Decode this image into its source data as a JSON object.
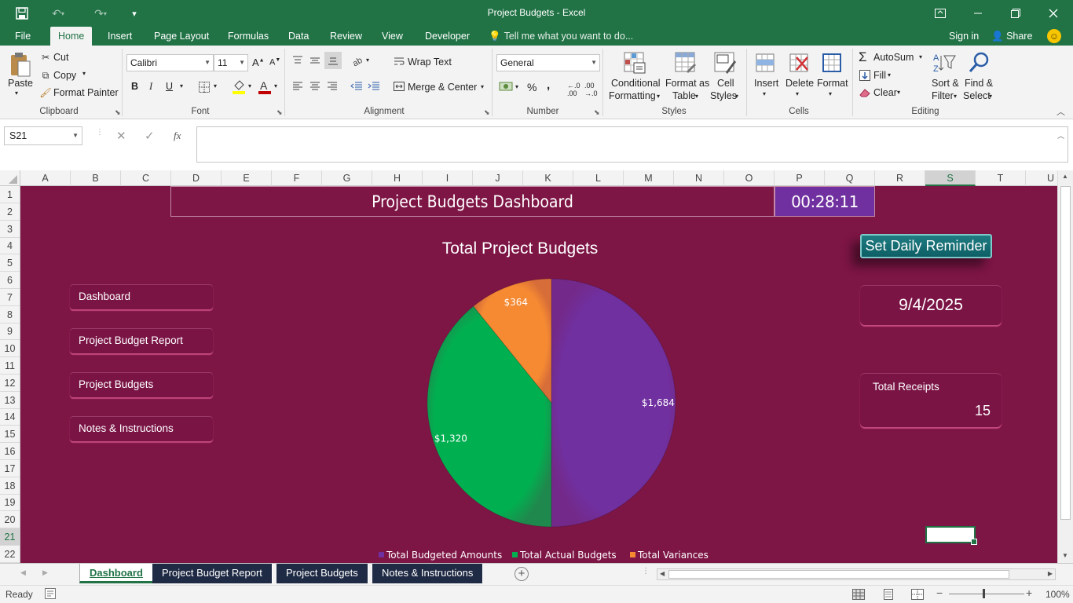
{
  "window": {
    "title": "Project Budgets - Excel"
  },
  "ribbon_tabs": [
    "File",
    "Home",
    "Insert",
    "Page Layout",
    "Formulas",
    "Data",
    "Review",
    "View",
    "Developer"
  ],
  "active_tab": "Home",
  "tell_me": "Tell me what you want to do...",
  "account": {
    "sign_in": "Sign in",
    "share": "Share"
  },
  "clipboard": {
    "paste": "Paste",
    "cut": "Cut",
    "copy": "Copy",
    "format_painter": "Format Painter",
    "group": "Clipboard"
  },
  "font": {
    "name": "Calibri",
    "size": "11",
    "bold": "B",
    "italic": "I",
    "underline": "U",
    "group": "Font"
  },
  "alignment": {
    "wrap_text": "Wrap Text",
    "merge_center": "Merge & Center",
    "group": "Alignment"
  },
  "number": {
    "format": "General",
    "percent": "%",
    "comma": ",",
    "group": "Number"
  },
  "styles": {
    "conditional": "Conditional",
    "formatting": "Formatting",
    "format_as": "Format as",
    "table": "Table",
    "cell": "Cell",
    "cell_styles": "Styles",
    "group": "Styles"
  },
  "cells": {
    "insert": "Insert",
    "delete": "Delete",
    "format": "Format",
    "group": "Cells"
  },
  "editing": {
    "autosum": "AutoSum",
    "fill": "Fill",
    "clear": "Clear",
    "sort_filter_1": "Sort &",
    "sort_filter_2": "Filter",
    "find_select_1": "Find &",
    "find_select_2": "Select",
    "group": "Editing"
  },
  "formula_bar": {
    "name_box": "S21",
    "fx": "fx",
    "content": ""
  },
  "columns": [
    "A",
    "B",
    "C",
    "D",
    "E",
    "F",
    "G",
    "H",
    "I",
    "J",
    "K",
    "L",
    "M",
    "N",
    "O",
    "P",
    "Q",
    "R",
    "S",
    "T",
    "U"
  ],
  "selected_column": "S",
  "rows": [
    "1",
    "2",
    "3",
    "4",
    "5",
    "6",
    "7",
    "8",
    "9",
    "10",
    "11",
    "12",
    "13",
    "14",
    "15",
    "16",
    "17",
    "18",
    "19",
    "20",
    "21",
    "22"
  ],
  "selected_row": "21",
  "dashboard": {
    "title": "Project Budgets Dashboard",
    "clock": "00:28:11",
    "nav_buttons": [
      "Dashboard",
      "Project Budget Report",
      "Project Budgets",
      "Notes & Instructions"
    ],
    "reminder_button": "Set Daily Reminder",
    "date": "9/4/2025",
    "receipts_label": "Total Receipts",
    "receipts_value": "15"
  },
  "chart_data": {
    "type": "pie",
    "title": "Total Project Budgets",
    "categories": [
      "Total Budgeted Amounts",
      "Total Actual Budgets",
      "Total Variances"
    ],
    "values": [
      1684,
      1320,
      364
    ],
    "data_labels": [
      "$1,684",
      "$1,320",
      "$364"
    ],
    "colors": [
      "#7030a0",
      "#00b050",
      "#f58a33"
    ],
    "legend": "bottom"
  },
  "sheet_tabs": [
    "Dashboard",
    "Project Budget Report",
    "Project Budgets",
    "Notes & Instructions"
  ],
  "active_sheet": "Dashboard",
  "status": {
    "ready": "Ready",
    "zoom": "100%"
  }
}
